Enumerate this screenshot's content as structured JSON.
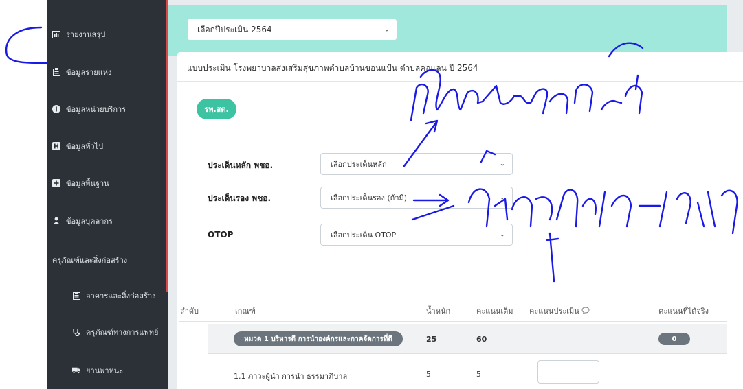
{
  "sidebar": {
    "items": [
      {
        "label": "รายงานสรุป",
        "icon": "bar-chart-icon"
      },
      {
        "label": "ข้อมูลรายแห่ง",
        "icon": "clipboard-icon"
      },
      {
        "label": "ข้อมูลหน่วยบริการ",
        "icon": "info-icon"
      },
      {
        "label": "ข้อมูลทั่วไป",
        "icon": "hospital-icon"
      },
      {
        "label": "ข้อมูลพื้นฐาน",
        "icon": "plus-square-icon"
      },
      {
        "label": "ข้อมูลบุคลากร",
        "icon": "users-icon"
      }
    ],
    "section_header": "ครุภัณฑ์และสิ่งก่อสร้าง",
    "sub_items": [
      {
        "label": "อาคารและสิ่งก่อสร้าง",
        "icon": "clipboard-icon"
      },
      {
        "label": "ครุภัณฑ์ทางการแพทย์",
        "icon": "stethoscope-icon"
      },
      {
        "label": "ยานพาหนะ",
        "icon": "truck-icon"
      }
    ]
  },
  "topbar": {
    "year_select": "เลือกปีประเมิน 2564"
  },
  "card": {
    "title": "แบบประเมิน โรงพยาบาลส่งเสริมสุขภาพตำบลบ้านขอนแป้น ตำบลคอแลน ปี 2564",
    "tag_button": "รพ.สต."
  },
  "form": {
    "main_issue_label": "ประเด็นหลัก พชอ.",
    "main_issue_placeholder": "เลือกประเด็นหลัก",
    "secondary_issue_label": "ประเด็นรอง พชอ.",
    "secondary_issue_placeholder": "เลือกประเด็นรอง (ถ้ามี)",
    "otop_label": "OTOP",
    "otop_placeholder": "เลือกประเด็น OTOP"
  },
  "table": {
    "headers": [
      "ลำดับ",
      "เกณฑ์",
      "น้ำหนัก",
      "คะแนนเต็ม",
      "คะแนนประเมิน",
      "คะแนนที่ได้จริง"
    ],
    "category": {
      "label": "หมวด 1 บริหารดี การนำองค์กรและกาคจัดการที่ดี",
      "weight": "25",
      "full_score": "60",
      "actual_score": "0"
    },
    "rows": [
      {
        "label": "1.1 ภาวะผู้นำ การนำ ธรรมาภิบาล",
        "weight": "5",
        "full_score": "5"
      }
    ]
  },
  "annotations": {
    "ink_color": "#1a1ae6"
  }
}
